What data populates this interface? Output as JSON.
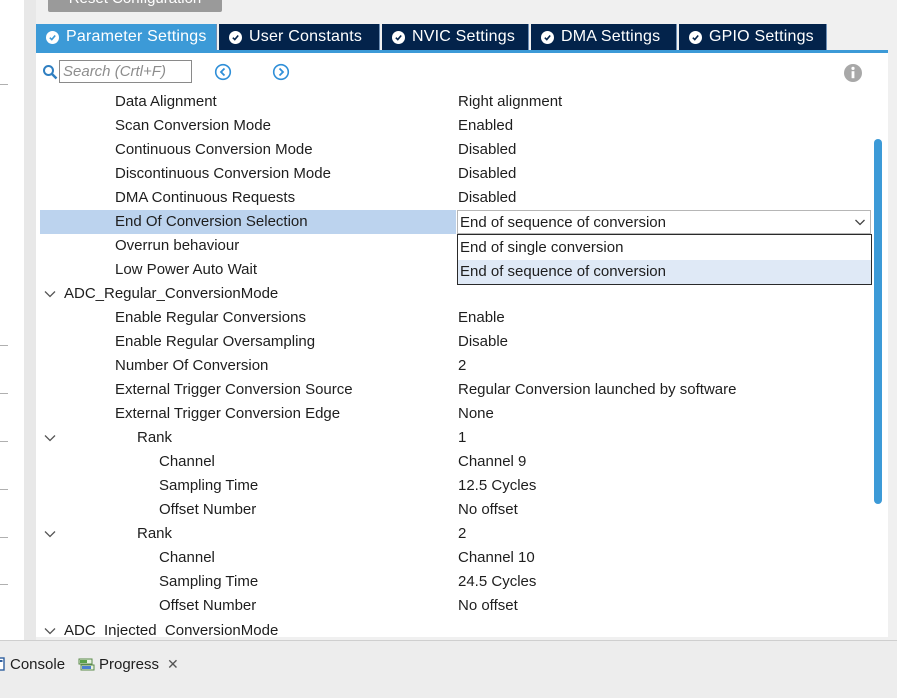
{
  "reset_button": {
    "label": "Reset Configuration"
  },
  "tabs": [
    {
      "label": "Parameter Settings",
      "active": true
    },
    {
      "label": "User Constants",
      "active": false
    },
    {
      "label": "NVIC Settings",
      "active": false
    },
    {
      "label": "DMA Settings",
      "active": false
    },
    {
      "label": "GPIO Settings",
      "active": false
    }
  ],
  "search": {
    "placeholder": "Search (Crtl+F)",
    "value": ""
  },
  "params": [
    {
      "name": "Data Alignment",
      "value": "Right alignment"
    },
    {
      "name": "Scan Conversion Mode",
      "value": "Enabled"
    },
    {
      "name": "Continuous Conversion Mode",
      "value": "Disabled"
    },
    {
      "name": "Discontinuous Conversion Mode",
      "value": "Disabled"
    },
    {
      "name": "DMA Continuous Requests",
      "value": "Disabled"
    },
    {
      "name": "End Of Conversion Selection",
      "value": "End of sequence of conversion"
    },
    {
      "name": "Overrun behaviour",
      "value": ""
    },
    {
      "name": "Low Power Auto Wait",
      "value": ""
    },
    {
      "name": "ADC_Regular_ConversionMode",
      "value": ""
    },
    {
      "name": "Enable Regular Conversions",
      "value": "Enable"
    },
    {
      "name": "Enable Regular Oversampling",
      "value": "Disable"
    },
    {
      "name": "Number Of Conversion",
      "value": "2"
    },
    {
      "name": "External Trigger Conversion Source",
      "value": "Regular Conversion launched by software"
    },
    {
      "name": "External Trigger Conversion Edge",
      "value": "None"
    },
    {
      "name": "Rank",
      "value": "1"
    },
    {
      "name": "Channel",
      "value": "Channel 9"
    },
    {
      "name": "Sampling Time",
      "value": "12.5 Cycles"
    },
    {
      "name": "Offset Number",
      "value": "No offset"
    },
    {
      "name": "Rank",
      "value": "2"
    },
    {
      "name": "Channel",
      "value": "Channel 10"
    },
    {
      "name": "Sampling Time",
      "value": "24.5 Cycles"
    },
    {
      "name": "Offset Number",
      "value": "No offset"
    },
    {
      "name": "ADC_Injected_ConversionMode",
      "value": ""
    }
  ],
  "dropdown": {
    "selected": "End of sequence of conversion",
    "options": [
      "End of single conversion",
      "End of sequence of conversion"
    ]
  },
  "bottom_tabs": [
    {
      "label": "Console"
    },
    {
      "label": "Progress"
    }
  ],
  "colors": {
    "tab_dark": "#03234b",
    "tab_active": "#3c9ad7",
    "row_selected": "#bcd3ee",
    "option_highlight": "#dfe9f6"
  }
}
